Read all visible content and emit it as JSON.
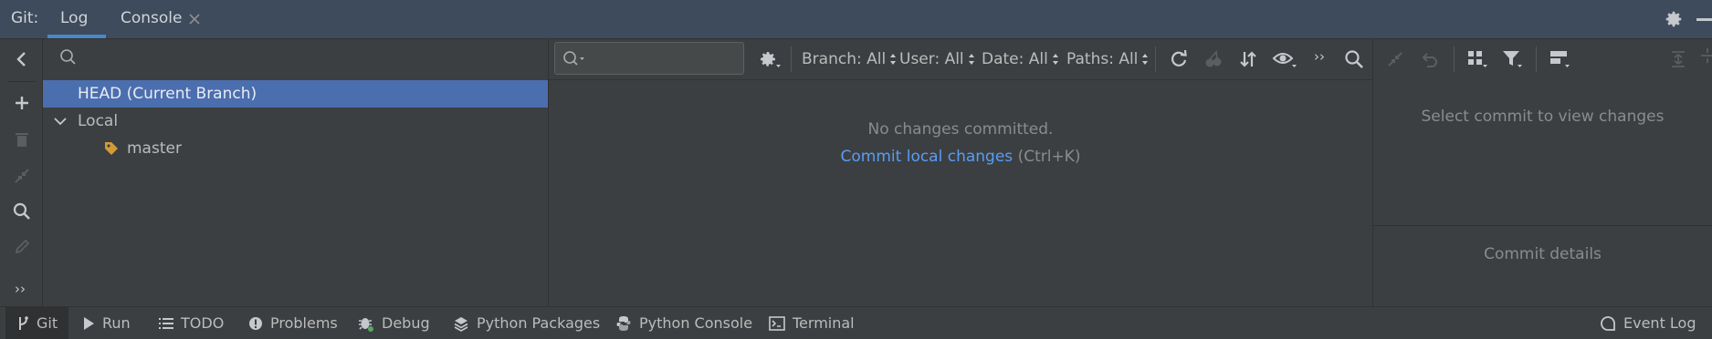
{
  "topbar": {
    "prefix": "Git:",
    "tabs": [
      {
        "label": "Log",
        "active": true
      },
      {
        "label": "Console",
        "closable": true
      }
    ]
  },
  "branches": {
    "search_placeholder": "",
    "items": [
      {
        "label": "HEAD (Current Branch)",
        "selected": true
      },
      {
        "label": "Local",
        "expanded": true
      },
      {
        "label": "master",
        "icon": "tag-icon"
      }
    ]
  },
  "log_toolbar": {
    "search_placeholder": "",
    "filters": {
      "branch": "Branch: All",
      "user": "User: All",
      "date": "Date: All",
      "paths": "Paths: All"
    }
  },
  "log_empty": {
    "message": "No changes committed.",
    "link": "Commit local changes",
    "shortcut": "(Ctrl+K)"
  },
  "details": {
    "changes_placeholder": "Select commit to view changes",
    "details_placeholder": "Commit details"
  },
  "bottombar": {
    "items": [
      {
        "label": "Git",
        "icon": "git-branch-icon",
        "active": true
      },
      {
        "label": "Run",
        "icon": "run-icon"
      },
      {
        "label": "TODO",
        "icon": "list-icon"
      },
      {
        "label": "Problems",
        "icon": "problems-icon"
      },
      {
        "label": "Debug",
        "icon": "bug-icon"
      },
      {
        "label": "Python Packages",
        "icon": "layers-icon"
      },
      {
        "label": "Python Console",
        "icon": "python-icon"
      },
      {
        "label": "Terminal",
        "icon": "terminal-icon"
      }
    ],
    "right": {
      "label": "Event Log",
      "icon": "event-log-icon"
    }
  },
  "colors": {
    "accent": "#4a88c7",
    "selection": "#4b6eaf",
    "link": "#589df6",
    "tag": "#d39a3a"
  }
}
